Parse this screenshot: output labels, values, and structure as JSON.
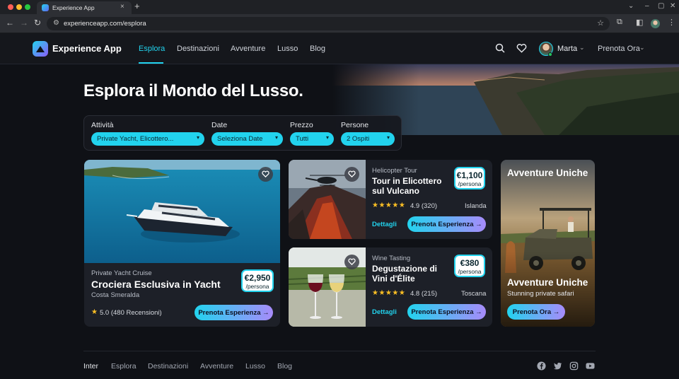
{
  "browser": {
    "tab_title": "Experience App",
    "url": "experienceapp.com/esplora",
    "tab_close": "×",
    "new_tab": "+"
  },
  "app": {
    "name": "Experience App",
    "menu": [
      "Esplora",
      "Destinazioni",
      "Avventure",
      "Lusso",
      "Blog"
    ],
    "active_menu": "Esplora",
    "user_name": "Marta",
    "book_link": "Prenota Ora"
  },
  "hero": {
    "title": "Esplora il Mondo del Lusso."
  },
  "filters": {
    "activity": {
      "label": "Attività",
      "value": "Private Yacht, Elicottero..."
    },
    "date": {
      "label": "Date",
      "value": "Seleziona Date"
    },
    "price": {
      "label": "Prezzo",
      "value": "Tutti"
    },
    "people": {
      "label": "Persone",
      "value": "2 Ospiti"
    }
  },
  "featured": {
    "category": "Private Yacht Cruise",
    "title": "Crociera Esclusiva in Yacht",
    "location": "Costa Smeralda",
    "price": "€2,950",
    "unit": "/persona",
    "rating": "5.0 (480 Recensioni)",
    "cta": "Prenota Esperienza →"
  },
  "experiences": [
    {
      "category": "Helicopter Tour",
      "title_line1": "Tour in Elicottero",
      "title_line2": "sul Vulcano",
      "price": "€1,100",
      "unit": "/persona",
      "rating": "4.9 (320)",
      "location": "Islanda",
      "details": "Dettagli",
      "cta": "Prenota Esperienza →"
    },
    {
      "category": "Wine Tasting",
      "title_line1": "Degustazione di",
      "title_line2": "Vini d'Élite",
      "price": "€380",
      "unit": "/persona",
      "rating": "4.8 (215)",
      "location": "Toscana",
      "details": "Dettagli",
      "cta": "Prenota Esperienza →"
    }
  ],
  "unique": {
    "heading": "Avventure Uniche",
    "title": "Avventure Uniche",
    "subtitle": "Stunning private safari",
    "cta": "Prenota Ora →"
  },
  "footer": {
    "links": [
      "Inter",
      "Esplora",
      "Destinazioni",
      "Avventure",
      "Lusso",
      "Blog"
    ],
    "social": [
      "facebook-icon",
      "twitter-icon",
      "instagram-icon",
      "youtube-icon"
    ]
  },
  "colors": {
    "accent": "#22d3ee",
    "accent_gradient_end": "#a78bfa",
    "background": "#0f1116",
    "card": "#1d2028",
    "star": "#fbbf24"
  }
}
